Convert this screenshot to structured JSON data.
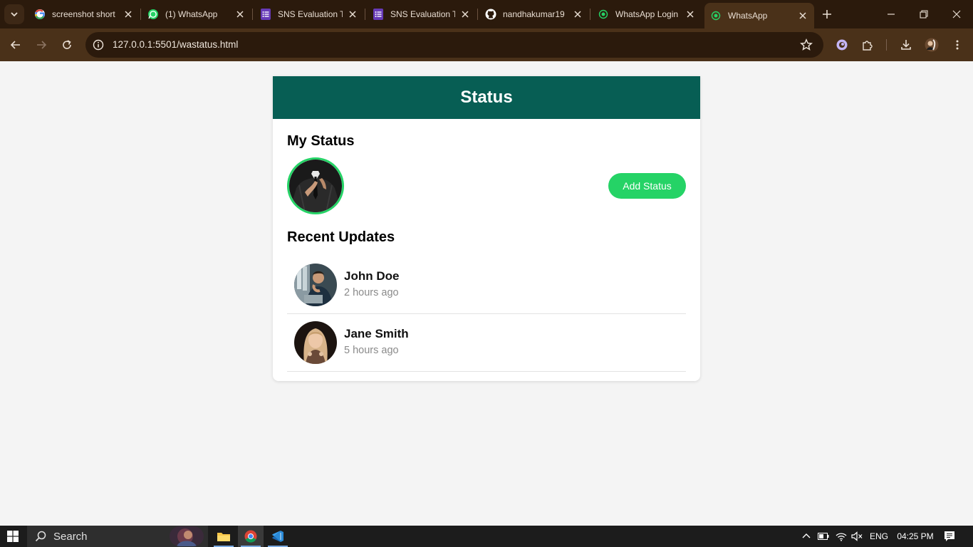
{
  "browser": {
    "tabs": [
      {
        "title": "screenshot short",
        "icon": "google-icon"
      },
      {
        "title": "(1) WhatsApp",
        "icon": "whatsapp-icon"
      },
      {
        "title": "SNS Evaluation T",
        "icon": "forms-icon"
      },
      {
        "title": "SNS Evaluation T",
        "icon": "forms-icon"
      },
      {
        "title": "nandhakumar19",
        "icon": "github-icon"
      },
      {
        "title": "WhatsApp Login",
        "icon": "whatsapp-icon"
      },
      {
        "title": "WhatsApp",
        "icon": "whatsapp-icon",
        "active": true
      }
    ],
    "url": "127.0.0.1:5501/wastatus.html",
    "colors": {
      "frame": "#2b1a0c",
      "toolbar": "#4a3119"
    }
  },
  "page": {
    "header_title": "Status",
    "my_status": {
      "title": "My Status",
      "add_button_label": "Add Status"
    },
    "recent": {
      "title": "Recent Updates",
      "items": [
        {
          "name": "John Doe",
          "time": "2 hours ago"
        },
        {
          "name": "Jane Smith",
          "time": "5 hours ago"
        }
      ]
    },
    "colors": {
      "header": "#075e54",
      "accent": "#25d366",
      "background": "#f4f4f4"
    }
  },
  "taskbar": {
    "search_placeholder": "Search",
    "language": "ENG",
    "time": "04:25 PM"
  }
}
